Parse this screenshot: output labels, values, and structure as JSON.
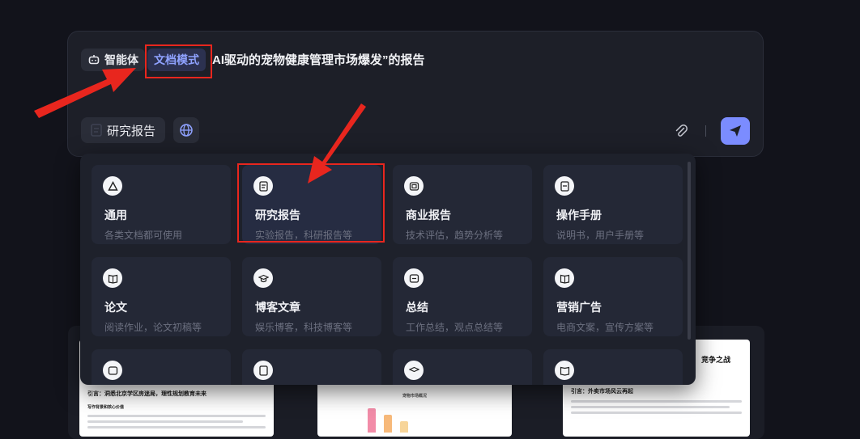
{
  "composer": {
    "agent_label": "智能体",
    "mode_label": "文档模式",
    "prompt_text": "AI驱动的宠物健康管理市场爆发”的报告",
    "report_label": "研究报告"
  },
  "doc_types": [
    {
      "title": "通用",
      "desc": "各类文档都可使用",
      "icon": "triangle-icon"
    },
    {
      "title": "研究报告",
      "desc": "实验报告，科研报告等",
      "icon": "report-icon"
    },
    {
      "title": "商业报告",
      "desc": "技术评估，趋势分析等",
      "icon": "briefcase-icon"
    },
    {
      "title": "操作手册",
      "desc": "说明书，用户手册等",
      "icon": "manual-icon"
    },
    {
      "title": "论文",
      "desc": "阅读作业，论文初稿等",
      "icon": "book-icon"
    },
    {
      "title": "博客文章",
      "desc": "娱乐博客，科技博客等",
      "icon": "graduation-icon"
    },
    {
      "title": "总结",
      "desc": "工作总结，观点总结等",
      "icon": "summary-icon"
    },
    {
      "title": "营销广告",
      "desc": "电商文案，宣传方案等",
      "icon": "book-open-icon"
    }
  ],
  "previews": {
    "doc1_title": "引言：洞悉北京学区房迷局，理性规划教育未来",
    "doc1_sub": "写作背景和核心价值",
    "doc2_title": "宠物市场概况",
    "doc3_heading": "竞争之战",
    "doc3_title": "引言：外卖市场风云再起"
  },
  "colors": {
    "accent": "#7b8cff",
    "annotation": "#e8261e"
  }
}
